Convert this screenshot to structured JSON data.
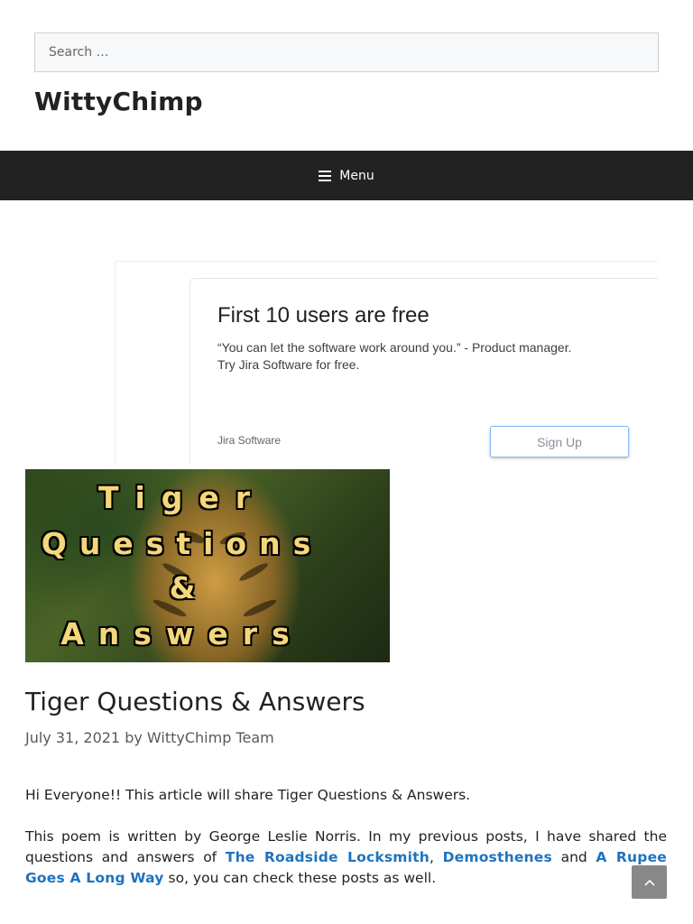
{
  "search": {
    "placeholder": "Search …"
  },
  "site": {
    "title": "WittyChimp"
  },
  "nav": {
    "menu_label": "Menu"
  },
  "ad": {
    "headline": "First 10 users are free",
    "line1": "“You can let the software work around you.” - Product manager.",
    "line2": "Try Jira Software for free.",
    "brand": "Jira Software",
    "cta": "Sign Up"
  },
  "featured_image": {
    "line1": "Tiger",
    "line2": "Questions",
    "line3": "&",
    "line4": "Answers"
  },
  "post": {
    "title": "Tiger Questions & Answers",
    "date": "July 31, 2021",
    "by": "by",
    "author": "WittyChimp Team",
    "intro": "Hi Everyone!! This article will share Tiger Questions & Answers.",
    "para_start": "This poem is written by George Leslie Norris. In my previous posts, I have shared the questions and answers of ",
    "link1": "The Roadside Locksmith",
    "sep1": ", ",
    "link2": "Demosthenes",
    "sep2": " and ",
    "link3": "A Rupee Goes A Long Way",
    "para_end": " so, you can check these posts as well."
  },
  "colors": {
    "nav_bg": "#222222",
    "link": "#1e73be",
    "image_text": "#f4d77a"
  },
  "icons": {
    "menu": "hamburger-icon",
    "back_to_top": "chevron-up-icon"
  }
}
